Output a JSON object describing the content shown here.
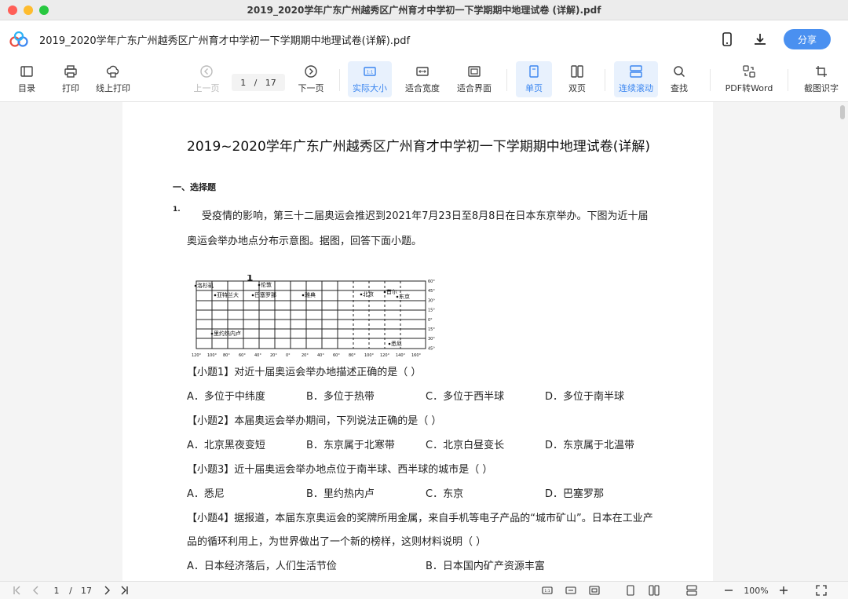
{
  "window": {
    "title": "2019_2020学年广东广州越秀区广州育才中学初一下学期期中地理试卷 (详解).pdf"
  },
  "header": {
    "doc_name": "2019_2020学年广东广州越秀区广州育才中学初一下学期期中地理试卷(详解).pdf",
    "share_label": "分享"
  },
  "toolbar": {
    "toc": "目录",
    "print": "打印",
    "online_print": "线上打印",
    "prev_page": "上一页",
    "current_page": "1",
    "page_sep": "/",
    "total_pages": "17",
    "next_page": "下一页",
    "actual_size": "实际大小",
    "fit_width": "适合宽度",
    "fit_page": "适合界面",
    "single_page": "单页",
    "double_page": "双页",
    "continuous_scroll": "连续滚动",
    "find": "查找",
    "pdf_to_word": "PDF转Word",
    "screenshot_ocr": "截图识字"
  },
  "document": {
    "title": "2019~2020学年广东广州越秀区广州育才中学初一下学期期中地理试卷(详解)",
    "section": "一、选择题",
    "question_number": "1.",
    "intro_line1": "受疫情的影响，第三十二届奥运会推迟到2021年7月23日至8月8日在日本东京举办。下图为近十届",
    "intro_line2": "奥运会举办地点分布示意图。据图，回答下面小题。",
    "map": {
      "top_number": "1",
      "cities": [
        "洛杉矶",
        "亚特兰大",
        "巴塞罗那",
        "伦敦",
        "雅典",
        "北京",
        "首尔",
        "东京",
        "里约热内卢",
        "悉尼"
      ],
      "lat_labels": [
        "60°",
        "45°",
        "30°",
        "15°",
        "0°",
        "15°",
        "30°",
        "45°"
      ],
      "lon_labels": [
        "120°",
        "100°",
        "80°",
        "60°",
        "40°",
        "20°",
        "0°",
        "20°",
        "40°",
        "60°",
        "80°",
        "100°",
        "120°",
        "140°",
        "160°"
      ]
    },
    "q1": "【小题1】对近十届奥运会举办地描述正确的是（    ）",
    "q1_options": [
      "A．多位于中纬度",
      "B．多位于热带",
      "C．多位于西半球",
      "D．多位于南半球"
    ],
    "q2": "【小题2】本届奥运会举办期间，下列说法正确的是（    ）",
    "q2_options": [
      "A．北京黑夜变短",
      "B．东京属于北寒带",
      "C．北京白昼变长",
      "D．东京属于北温带"
    ],
    "q3": "【小题3】近十届奥运会举办地点位于南半球、西半球的城市是（    ）",
    "q3_options": [
      "A．悉尼",
      "B．里约热内卢",
      "C．东京",
      "D．巴塞罗那"
    ],
    "q4_line1": "【小题4】据报道，本届东京奥运会的奖牌所用金属，来自手机等电子产品的“城市矿山”。日本在工业产",
    "q4_line2": "品的循环利用上，为世界做出了一个新的榜样，这则材料说明（    ）",
    "q4_options": [
      "A．日本经济落后，人们生活节俭",
      "B．日本国内矿产资源丰富"
    ]
  },
  "statusbar": {
    "current_page": "1",
    "page_sep": "/",
    "total_pages": "17",
    "zoom": "100%"
  },
  "colors": {
    "accent": "#3b86f0",
    "share_button": "#4a90f0"
  }
}
